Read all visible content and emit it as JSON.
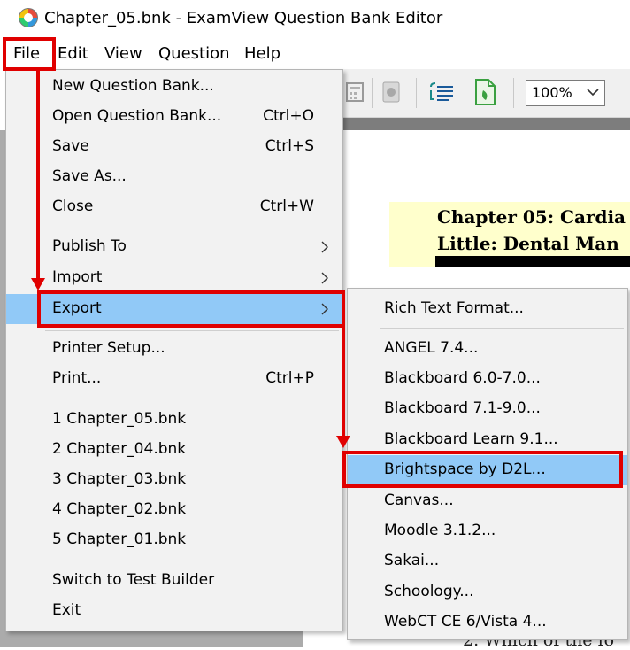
{
  "window": {
    "title": "Chapter_05.bnk - ExamView Question Bank Editor"
  },
  "menubar": {
    "items": [
      "File",
      "Edit",
      "View",
      "Question",
      "Help"
    ]
  },
  "toolbar": {
    "zoom": "100%"
  },
  "document": {
    "heading_line1": "Chapter 05: Cardia",
    "heading_line2": "Little: Dental Man",
    "fragment_bottom": "2.   Which of the fo"
  },
  "file_menu": {
    "new": "New Question Bank...",
    "open": "Open Question Bank...",
    "open_shortcut": "Ctrl+O",
    "save": "Save",
    "save_shortcut": "Ctrl+S",
    "save_as": "Save As...",
    "close": "Close",
    "close_shortcut": "Ctrl+W",
    "publish_to": "Publish To",
    "import": "Import",
    "export": "Export",
    "printer_setup": "Printer Setup...",
    "print": "Print...",
    "print_shortcut": "Ctrl+P",
    "recent": [
      "1 Chapter_05.bnk",
      "2 Chapter_04.bnk",
      "3 Chapter_03.bnk",
      "4 Chapter_02.bnk",
      "5 Chapter_01.bnk"
    ],
    "switch": "Switch to Test Builder",
    "exit": "Exit"
  },
  "export_menu": {
    "items": [
      "Rich Text Format...",
      "ANGEL 7.4...",
      "Blackboard 6.0-7.0...",
      "Blackboard 7.1-9.0...",
      "Blackboard Learn 9.1...",
      "Brightspace by D2L...",
      "Canvas...",
      "Moodle 3.1.2...",
      "Sakai...",
      "Schoology...",
      "WebCT CE 6/Vista 4..."
    ]
  },
  "colors": {
    "highlight": "#91c9f7",
    "annotation": "#e00000"
  }
}
